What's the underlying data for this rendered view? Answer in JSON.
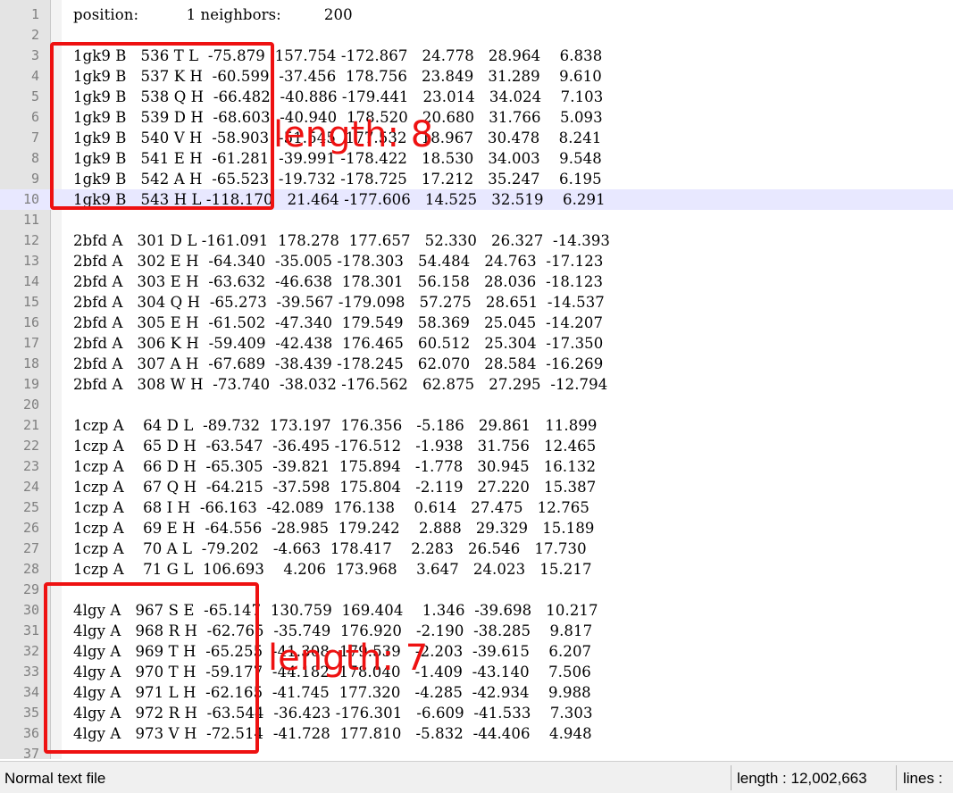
{
  "editor": {
    "lines": [
      {
        "n": "1",
        "text": "position:          1 neighbors:         200"
      },
      {
        "n": "2",
        "text": ""
      },
      {
        "n": "3",
        "text": "1gk9 B   536 T L  -75.879  157.754 -172.867   24.778   28.964    6.838"
      },
      {
        "n": "4",
        "text": "1gk9 B   537 K H  -60.599  -37.456  178.756   23.849   31.289    9.610"
      },
      {
        "n": "5",
        "text": "1gk9 B   538 Q H  -66.482  -40.886 -179.441   23.014   34.024    7.103"
      },
      {
        "n": "6",
        "text": "1gk9 B   539 D H  -68.603  -40.940  178.520   20.680   31.766    5.093"
      },
      {
        "n": "7",
        "text": "1gk9 B   540 V H  -58.903  -51.545  177.532   18.967   30.478    8.241"
      },
      {
        "n": "8",
        "text": "1gk9 B   541 E H  -61.281  -39.991 -178.422   18.530   34.003    9.548"
      },
      {
        "n": "9",
        "text": "1gk9 B   542 A H  -65.523  -19.732 -178.725   17.212   35.247    6.195"
      },
      {
        "n": "10",
        "text": "1gk9 B   543 H L -118.170   21.464 -177.606   14.525   32.519    6.291"
      },
      {
        "n": "11",
        "text": ""
      },
      {
        "n": "12",
        "text": "2bfd A   301 D L -161.091  178.278  177.657   52.330   26.327  -14.393"
      },
      {
        "n": "13",
        "text": "2bfd A   302 E H  -64.340  -35.005 -178.303   54.484   24.763  -17.123"
      },
      {
        "n": "14",
        "text": "2bfd A   303 E H  -63.632  -46.638  178.301   56.158   28.036  -18.123"
      },
      {
        "n": "15",
        "text": "2bfd A   304 Q H  -65.273  -39.567 -179.098   57.275   28.651  -14.537"
      },
      {
        "n": "16",
        "text": "2bfd A   305 E H  -61.502  -47.340  179.549   58.369   25.045  -14.207"
      },
      {
        "n": "17",
        "text": "2bfd A   306 K H  -59.409  -42.438  176.465   60.512   25.304  -17.350"
      },
      {
        "n": "18",
        "text": "2bfd A   307 A H  -67.689  -38.439 -178.245   62.070   28.584  -16.269"
      },
      {
        "n": "19",
        "text": "2bfd A   308 W H  -73.740  -38.032 -176.562   62.875   27.295  -12.794"
      },
      {
        "n": "20",
        "text": ""
      },
      {
        "n": "21",
        "text": "1czp A    64 D L  -89.732  173.197  176.356   -5.186   29.861   11.899"
      },
      {
        "n": "22",
        "text": "1czp A    65 D H  -63.547  -36.495 -176.512   -1.938   31.756   12.465"
      },
      {
        "n": "23",
        "text": "1czp A    66 D H  -65.305  -39.821  175.894   -1.778   30.945   16.132"
      },
      {
        "n": "24",
        "text": "1czp A    67 Q H  -64.215  -37.598  175.804   -2.119   27.220   15.387"
      },
      {
        "n": "25",
        "text": "1czp A    68 I H  -66.163  -42.089  176.138    0.614   27.475   12.765"
      },
      {
        "n": "26",
        "text": "1czp A    69 E H  -64.556  -28.985  179.242    2.888   29.329   15.189"
      },
      {
        "n": "27",
        "text": "1czp A    70 A L  -79.202   -4.663  178.417    2.283   26.546   17.730"
      },
      {
        "n": "28",
        "text": "1czp A    71 G L  106.693    4.206  173.968    3.647   24.023   15.217"
      },
      {
        "n": "29",
        "text": ""
      },
      {
        "n": "30",
        "text": "4lgy A   967 S E  -65.147  130.759  169.404    1.346  -39.698   10.217"
      },
      {
        "n": "31",
        "text": "4lgy A   968 R H  -62.765  -35.749  176.920   -2.190  -38.285    9.817"
      },
      {
        "n": "32",
        "text": "4lgy A   969 T H  -65.255  -41.308 -179.539   -2.203  -39.615    6.207"
      },
      {
        "n": "33",
        "text": "4lgy A   970 T H  -59.177  -44.182  178.040   -1.409  -43.140    7.506"
      },
      {
        "n": "34",
        "text": "4lgy A   971 L H  -62.165  -41.745  177.320   -4.285  -42.934    9.988"
      },
      {
        "n": "35",
        "text": "4lgy A   972 R H  -63.544  -36.423 -176.301   -6.609  -41.533    7.303"
      },
      {
        "n": "36",
        "text": "4lgy A   973 V H  -72.514  -41.728  177.810   -5.832  -44.406    4.948"
      },
      {
        "n": "37",
        "text": ""
      }
    ],
    "current_line": "10"
  },
  "annotations": {
    "first_label": "length: 8",
    "second_label": "length: 7",
    "color": "#ee1111"
  },
  "statusbar": {
    "file_type": "Normal text file",
    "length": "length : 12,002,663",
    "lines": "lines : "
  }
}
